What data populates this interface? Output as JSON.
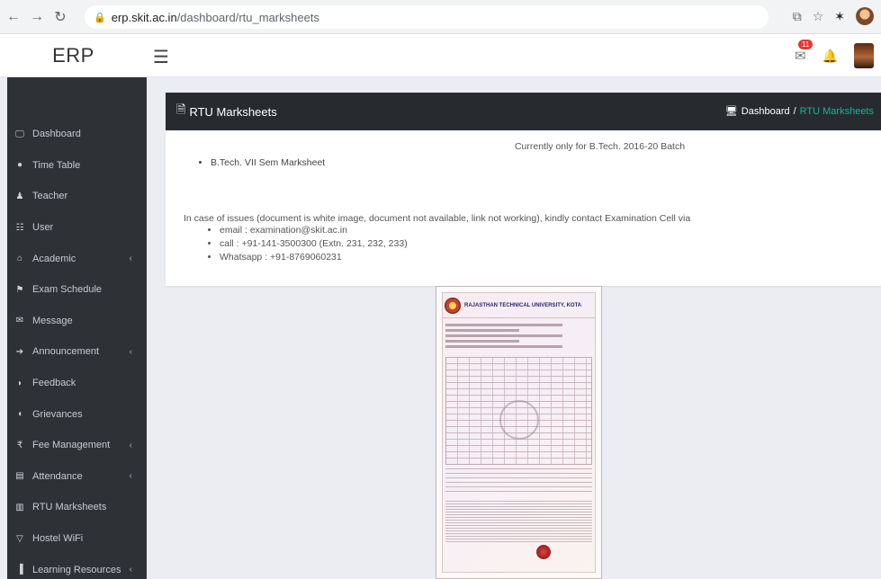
{
  "browser": {
    "url_host": "erp.skit.ac.in",
    "url_path": "/dashboard/rtu_marksheets"
  },
  "app": {
    "logo": "ERP",
    "notification_count": "11"
  },
  "sidebar": {
    "items": [
      {
        "label": "Dashboard",
        "icon": "desktop-icon",
        "chevron": false
      },
      {
        "label": "Time Table",
        "icon": "circle-icon",
        "chevron": false
      },
      {
        "label": "Teacher",
        "icon": "teacher-icon",
        "chevron": false
      },
      {
        "label": "User",
        "icon": "users-icon",
        "chevron": false
      },
      {
        "label": "Academic",
        "icon": "academic-icon",
        "chevron": true
      },
      {
        "label": "Exam Schedule",
        "icon": "schedule-icon",
        "chevron": false
      },
      {
        "label": "Message",
        "icon": "envelope-icon",
        "chevron": false
      },
      {
        "label": "Announcement",
        "icon": "bullhorn-icon",
        "chevron": true
      },
      {
        "label": "Feedback",
        "icon": "comment-icon",
        "chevron": false
      },
      {
        "label": "Grievances",
        "icon": "comments-icon",
        "chevron": false
      },
      {
        "label": "Fee Management",
        "icon": "rupee-icon",
        "chevron": true
      },
      {
        "label": "Attendance",
        "icon": "file-icon",
        "chevron": true
      },
      {
        "label": "RTU Marksheets",
        "icon": "document-icon",
        "chevron": false
      },
      {
        "label": "Hostel WiFi",
        "icon": "wifi-icon",
        "chevron": false
      },
      {
        "label": "Learning Resources",
        "icon": "books-icon",
        "chevron": true
      }
    ]
  },
  "card": {
    "title": "RTU Marksheets",
    "breadcrumb_home": "Dashboard",
    "breadcrumb_sep": "/",
    "breadcrumb_current": "RTU Marksheets",
    "notice": "Currently only for B.Tech. 2016-20 Batch",
    "marksheet_link": "B.Tech. VII Sem Marksheet",
    "issue_text": "In case of issues (document is white image, document not available, link not working), kindly contact Examination Cell via",
    "contacts": [
      "email : examination@skit.ac.in",
      "call : +91-141-3500300 (Extn. 231, 232, 233)",
      "Whatsapp : +91-8769060231"
    ]
  },
  "marksheet_image": {
    "university": "RAJASTHAN TECHNICAL UNIVERSITY, KOTA"
  }
}
